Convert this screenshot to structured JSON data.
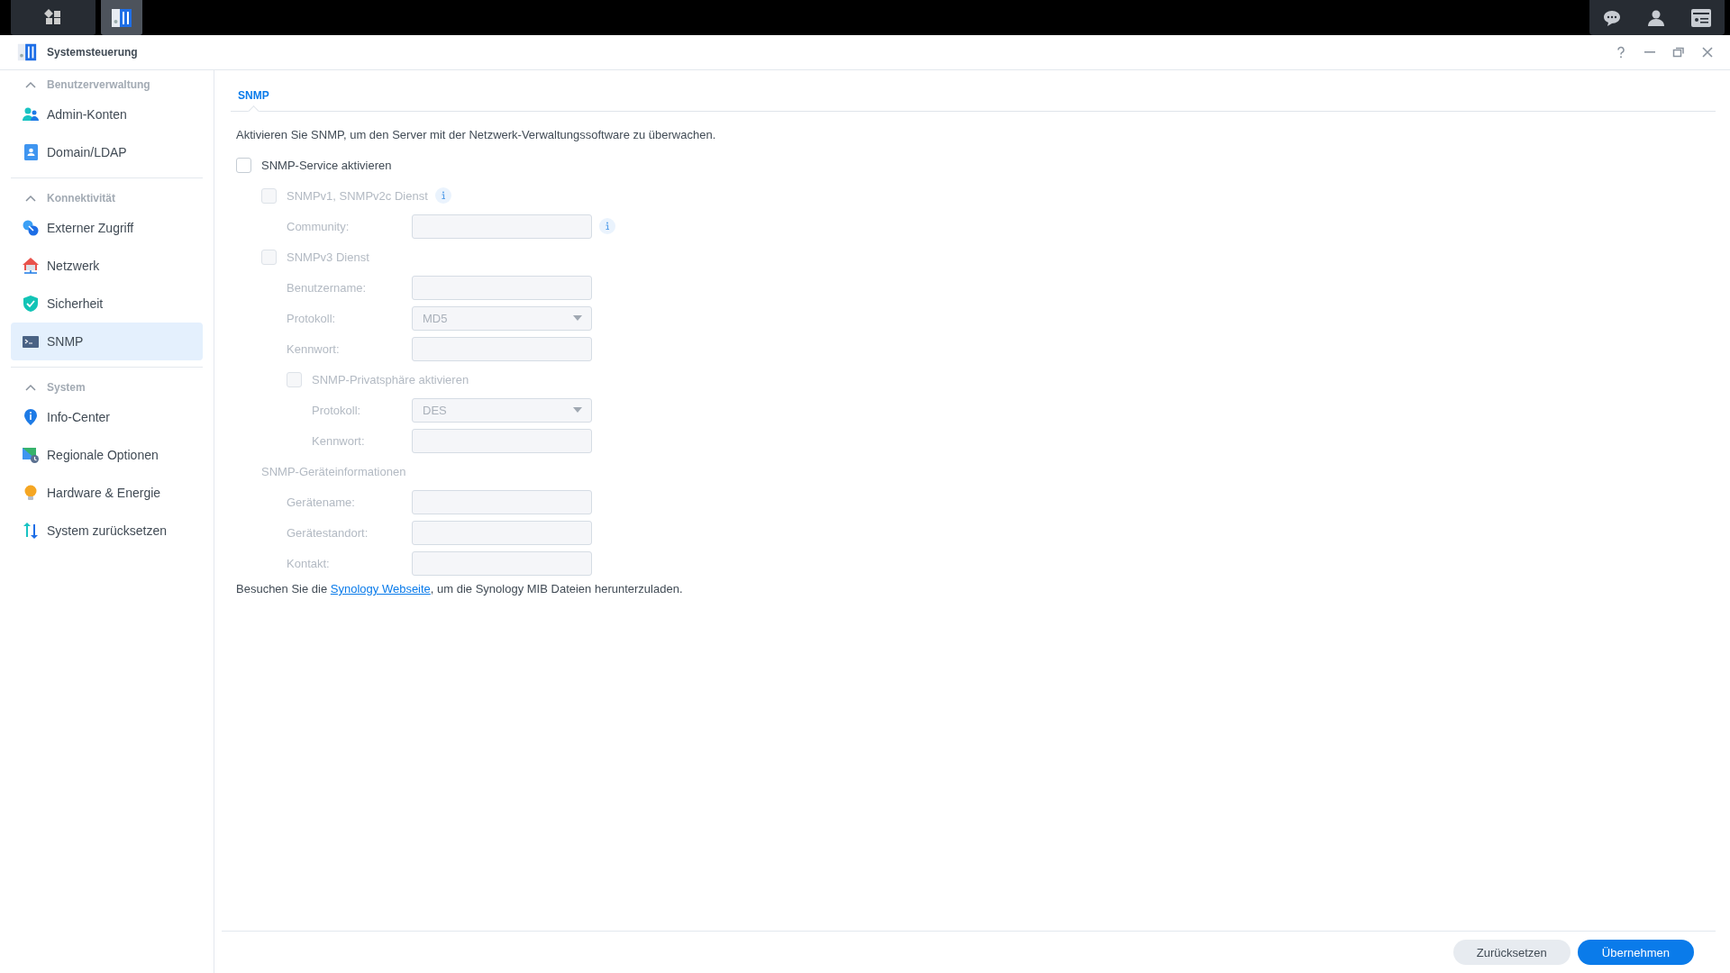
{
  "window": {
    "title": "Systemsteuerung"
  },
  "sidebar": {
    "groups": [
      {
        "title": "Benutzerverwaltung",
        "expanded": true,
        "items": [
          {
            "label": "Admin-Konten",
            "selected": false
          },
          {
            "label": "Domain/LDAP",
            "selected": false
          }
        ]
      },
      {
        "title": "Konnektivität",
        "expanded": true,
        "items": [
          {
            "label": "Externer Zugriff",
            "selected": false
          },
          {
            "label": "Netzwerk",
            "selected": false
          },
          {
            "label": "Sicherheit",
            "selected": false
          },
          {
            "label": "SNMP",
            "selected": true
          }
        ]
      },
      {
        "title": "System",
        "expanded": true,
        "items": [
          {
            "label": "Info-Center",
            "selected": false
          },
          {
            "label": "Regionale Optionen",
            "selected": false
          },
          {
            "label": "Hardware & Energie",
            "selected": false
          },
          {
            "label": "System zurücksetzen",
            "selected": false
          }
        ]
      }
    ]
  },
  "tabs": [
    {
      "label": "SNMP",
      "selected": true
    }
  ],
  "description": "Aktivieren Sie SNMP, um den Server mit der Netzwerk-Verwaltungssoftware zu überwachen.",
  "form": {
    "items": [
      {
        "kind": "checkbox",
        "label": "SNMP-Service aktivieren",
        "checked": false,
        "disabled": false,
        "children": [
          {
            "kind": "checkbox",
            "label": "SNMPv1, SNMPv2c Dienst",
            "checked": false,
            "disabled": true,
            "info": true,
            "children": [
              {
                "kind": "field",
                "label": "Community:",
                "disabled": true,
                "info": true
              }
            ]
          },
          {
            "kind": "checkbox",
            "label": "SNMPv3 Dienst",
            "checked": false,
            "disabled": true,
            "children": [
              {
                "kind": "field",
                "label": "Benutzername:",
                "disabled": true
              },
              {
                "kind": "select",
                "label": "Protokoll:",
                "value": "MD5",
                "disabled": true
              },
              {
                "kind": "field",
                "label": "Kennwort:",
                "disabled": true
              },
              {
                "kind": "checkbox",
                "label": "SNMP-Privatsphäre aktivieren",
                "checked": false,
                "disabled": true,
                "children": [
                  {
                    "kind": "select",
                    "label": "Protokoll:",
                    "value": "DES",
                    "disabled": true
                  },
                  {
                    "kind": "field",
                    "label": "Kennwort:",
                    "disabled": true
                  }
                ]
              }
            ]
          },
          {
            "kind": "heading",
            "label": "SNMP-Geräteinformationen",
            "disabled": true,
            "children": [
              {
                "kind": "field",
                "label": "Gerätename:",
                "disabled": true
              },
              {
                "kind": "field",
                "label": "Gerätestandort:",
                "disabled": true
              },
              {
                "kind": "field",
                "label": "Kontakt:",
                "disabled": true
              }
            ]
          }
        ]
      }
    ]
  },
  "footnote": {
    "before": "Besuchen Sie die ",
    "link": "Synology Webseite",
    "after": ", um die Synology MIB Dateien herunterzuladen."
  },
  "buttons": [
    {
      "label": "Zurücksetzen",
      "kind": "secondary"
    },
    {
      "label": "Übernehmen",
      "kind": "primary"
    }
  ]
}
